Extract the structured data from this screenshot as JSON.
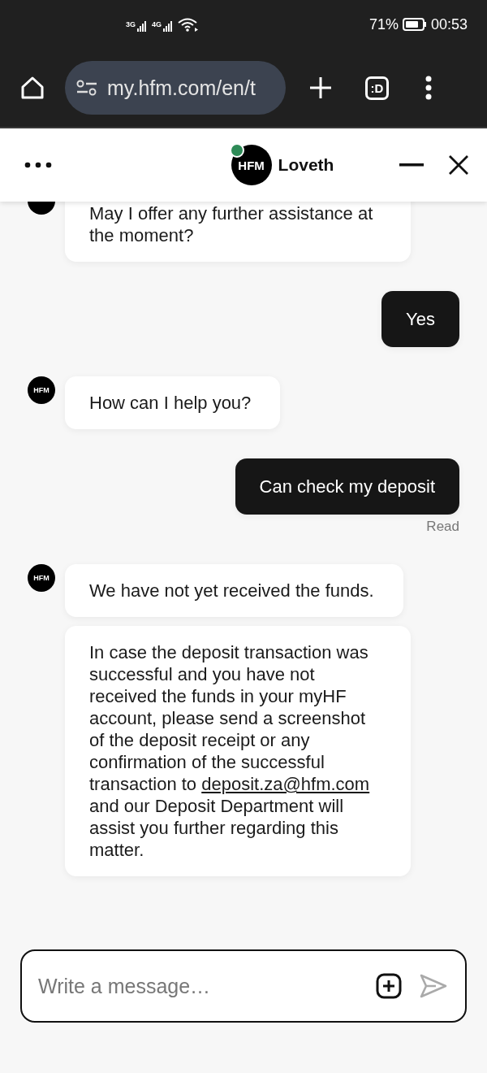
{
  "status_bar": {
    "network_1": "3G",
    "network_2": "4G",
    "battery": "71%",
    "time": "00:53"
  },
  "browser": {
    "url": "my.hfm.com/en/t",
    "tabs_label": ":D"
  },
  "chat_header": {
    "agent_name": "Loveth",
    "logo": "HFM",
    "online": true
  },
  "messages": [
    {
      "kind": "agent",
      "bubbles": [
        {
          "text": "May I offer any further assistance at the moment?"
        }
      ]
    },
    {
      "kind": "user",
      "bubbles": [
        {
          "text": "Yes"
        }
      ]
    },
    {
      "kind": "agent",
      "logo": "HFM",
      "bubbles": [
        {
          "text": "How can I help you?"
        }
      ]
    },
    {
      "kind": "user",
      "bubbles": [
        {
          "text": "Can check my deposit"
        }
      ],
      "receipt": "Read"
    },
    {
      "kind": "agent",
      "logo": "HFM",
      "bubbles": [
        {
          "text": "We have not yet received the funds."
        },
        {
          "text": "In case the deposit transaction was successful and you have not received the funds in your myHF account, please send a screenshot of the deposit receipt or any confirmation of the successful transaction to",
          "link": "deposit.za@hfm.com",
          "text_after": "and our Deposit Department will assist you further regarding this matter."
        }
      ]
    }
  ],
  "composer": {
    "placeholder": "Write a message…"
  }
}
